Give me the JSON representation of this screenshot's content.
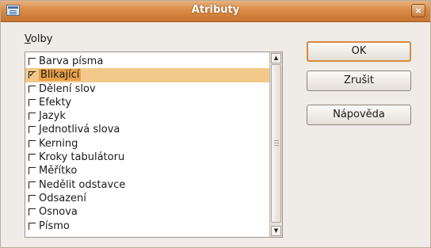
{
  "window": {
    "title": "Atributy",
    "close_glyph": "×"
  },
  "section": {
    "label_mnemonic": "V",
    "label_rest": "olby"
  },
  "options": [
    {
      "label": "Barva písma",
      "checked": false,
      "selected": false
    },
    {
      "label": "Blikající",
      "checked": true,
      "selected": true
    },
    {
      "label": "Dělení slov",
      "checked": false,
      "selected": false
    },
    {
      "label": "Efekty",
      "checked": false,
      "selected": false
    },
    {
      "label": "Jazyk",
      "checked": false,
      "selected": false
    },
    {
      "label": "Jednotlivá slova",
      "checked": false,
      "selected": false
    },
    {
      "label": "Kerning",
      "checked": false,
      "selected": false
    },
    {
      "label": "Kroky tabulátoru",
      "checked": false,
      "selected": false
    },
    {
      "label": "Měřítko",
      "checked": false,
      "selected": false
    },
    {
      "label": "Nedělit odstavce",
      "checked": false,
      "selected": false
    },
    {
      "label": "Odsazení",
      "checked": false,
      "selected": false
    },
    {
      "label": "Osnova",
      "checked": false,
      "selected": false
    },
    {
      "label": "Písmo",
      "checked": false,
      "selected": false
    }
  ],
  "buttons": {
    "ok": "OK",
    "cancel": "Zrušit",
    "help": "Nápověda"
  },
  "scroll": {
    "up_glyph": "▲",
    "down_glyph": "▼"
  },
  "colors": {
    "titlebar": "#d98b47",
    "selection": "#e8a14a",
    "default_button_border": "#d58a3e"
  },
  "icons": {
    "window": "dialog-window-icon",
    "close": "close-icon"
  }
}
